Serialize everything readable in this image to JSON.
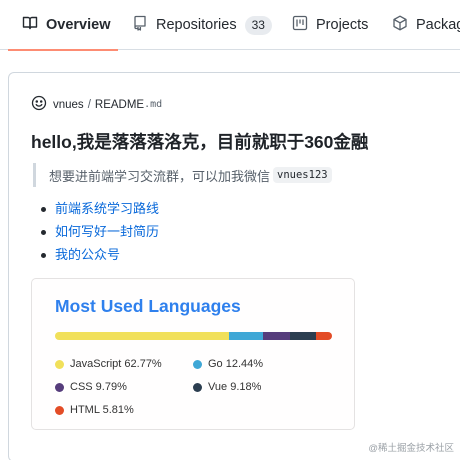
{
  "tabs": [
    {
      "label": "Overview",
      "icon": "book-icon",
      "selected": true
    },
    {
      "label": "Repositories",
      "icon": "repo-icon",
      "count": "33"
    },
    {
      "label": "Projects",
      "icon": "project-icon"
    },
    {
      "label": "Packages",
      "icon": "package-icon"
    }
  ],
  "readme": {
    "owner": "vnues",
    "separator": "/",
    "file_name": "README",
    "file_ext": ".md",
    "heading": "hello,我是落落落洛克，目前就职于360金融",
    "quote": "想要进前端学习交流群，可以加我微信",
    "wechat_code": "vnues123",
    "links": [
      "前端系统学习路线",
      "如何写好一封简历",
      "我的公众号"
    ]
  },
  "languages": {
    "title": "Most Used Languages",
    "items": [
      {
        "name": "JavaScript",
        "percent": 62.77,
        "label": "JavaScript 62.77%",
        "color": "#f1e05a"
      },
      {
        "name": "Go",
        "percent": 12.44,
        "label": "Go 12.44%",
        "color": "#3fa7d6"
      },
      {
        "name": "CSS",
        "percent": 9.79,
        "label": "CSS 9.79%",
        "color": "#563d7c"
      },
      {
        "name": "Vue",
        "percent": 9.18,
        "label": "Vue 9.18%",
        "color": "#2c3e50"
      },
      {
        "name": "HTML",
        "percent": 5.81,
        "label": "HTML 5.81%",
        "color": "#e34c26"
      }
    ]
  },
  "colors": {
    "accent_underline": "#fd8c73",
    "link": "#0969da",
    "lang_title": "#2f80ed"
  },
  "watermark": "@稀土掘金技术社区"
}
